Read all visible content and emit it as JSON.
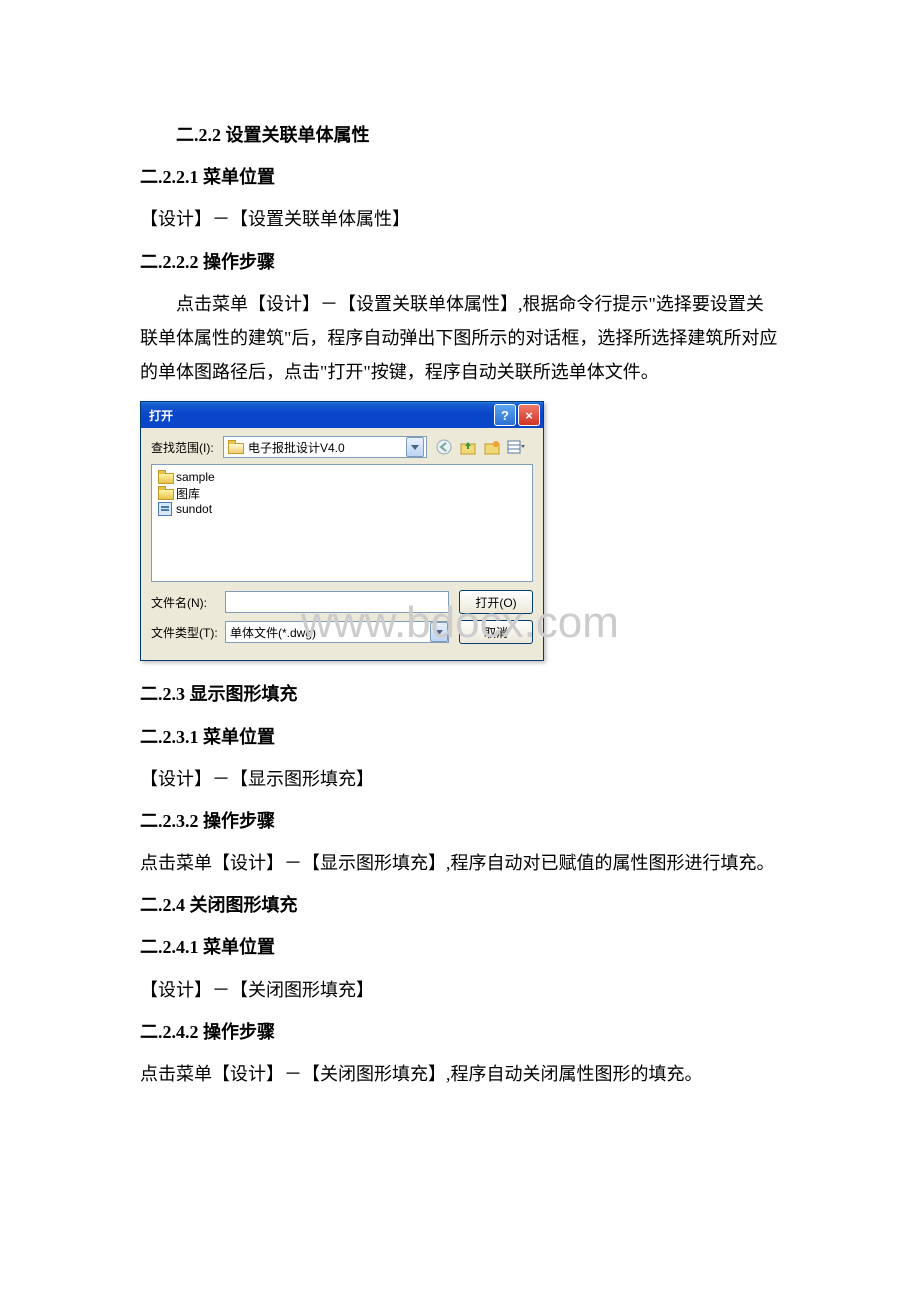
{
  "watermark": "www.bdocx.com",
  "sections": {
    "h_2_2_2": "二.2.2 设置关联单体属性",
    "h_2_2_2_1": "二.2.2.1 菜单位置",
    "p_2_2_2_1": "【设计】－【设置关联单体属性】",
    "h_2_2_2_2": "二.2.2.2 操作步骤",
    "p_2_2_2_2": "点击菜单【设计】－【设置关联单体属性】,根据命令行提示\"选择要设置关联单体属性的建筑\"后，程序自动弹出下图所示的对话框，选择所选择建筑所对应的单体图路径后，点击\"打开\"按键，程序自动关联所选单体文件。",
    "h_2_2_3": "二.2.3 显示图形填充",
    "h_2_2_3_1": "二.2.3.1 菜单位置",
    "p_2_2_3_1": "【设计】－【显示图形填充】",
    "h_2_2_3_2": "二.2.3.2 操作步骤",
    "p_2_2_3_2": "点击菜单【设计】－【显示图形填充】,程序自动对已赋值的属性图形进行填充。",
    "h_2_2_4": "二.2.4 关闭图形填充",
    "h_2_2_4_1": "二.2.4.1 菜单位置",
    "p_2_2_4_1": "【设计】－【关闭图形填充】",
    "h_2_2_4_2": "二.2.4.2 操作步骤",
    "p_2_2_4_2": "点击菜单【设计】－【关闭图形填充】,程序自动关闭属性图形的填充。"
  },
  "dialog": {
    "title": "打开",
    "help_symbol": "?",
    "close_symbol": "×",
    "lookin_label": "查找范围(I):",
    "lookin_value": "电子报批设计V4.0",
    "files": [
      {
        "name": "sample",
        "type": "folder"
      },
      {
        "name": "图库",
        "type": "folder"
      },
      {
        "name": "sundot",
        "type": "doc"
      }
    ],
    "filename_label": "文件名(N):",
    "filename_value": "",
    "filetype_label": "文件类型(T):",
    "filetype_value": "单体文件(*.dwg)",
    "open_btn": "打开(O)",
    "cancel_btn": "取消"
  }
}
